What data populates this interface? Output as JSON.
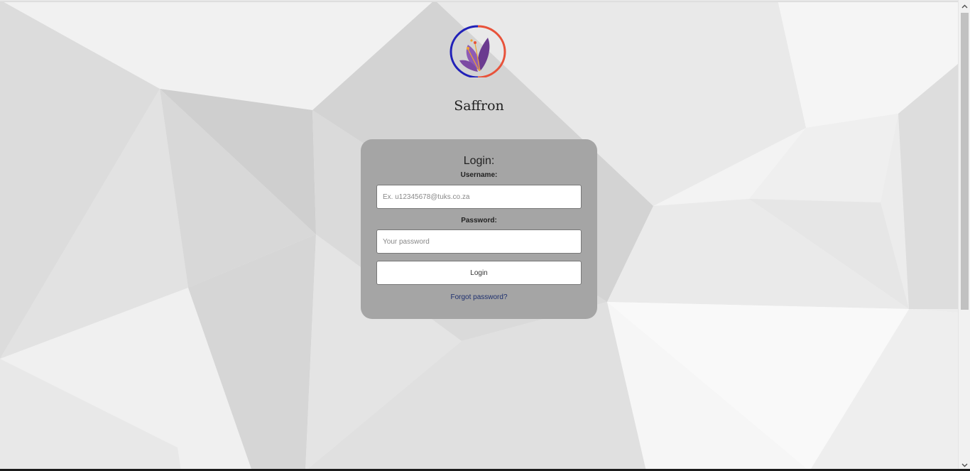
{
  "brand": {
    "name": "Saffron",
    "logo_icon": "saffron-flower-icon",
    "colors": {
      "ring_left": "#2121b8",
      "ring_right": "#e8523a",
      "petals": "#6a3a8f"
    }
  },
  "login": {
    "title": "Login:",
    "username_label": "Username:",
    "username_placeholder": "Ex. u12345678@tuks.co.za",
    "username_value": "",
    "password_label": "Password:",
    "password_placeholder": "Your password",
    "password_value": "",
    "button_label": "Login",
    "forgot_link": "Forgot password?"
  },
  "colors": {
    "card_bg": "#a5a5a5",
    "page_bg": "#ececec",
    "link": "#1d2f6e"
  },
  "scrollbar": {
    "up_icon": "chevron-up-icon",
    "down_icon": "chevron-down-icon"
  }
}
